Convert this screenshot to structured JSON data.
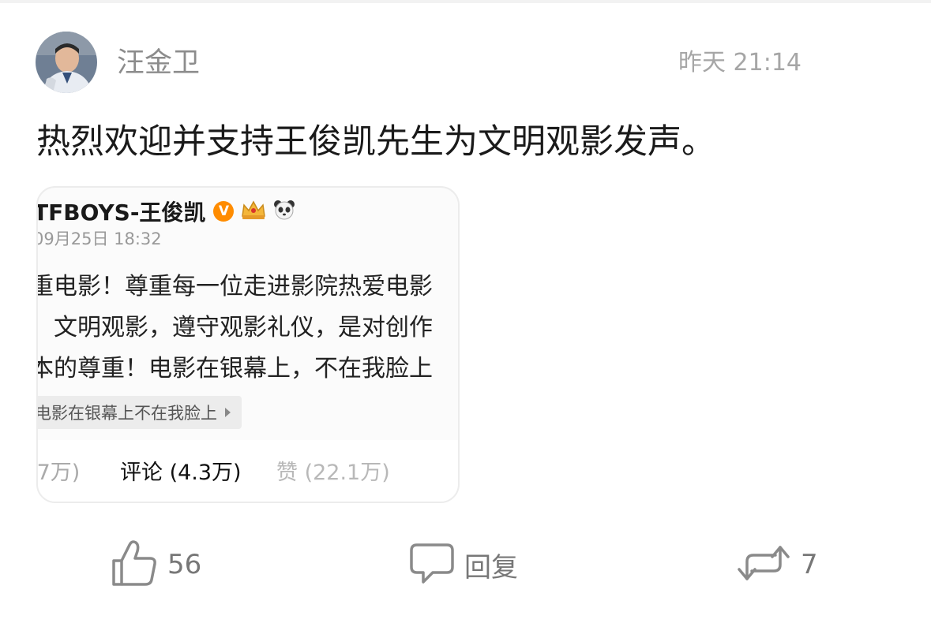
{
  "post": {
    "author": "汪金卫",
    "time": "昨天 21:14",
    "text": "热烈欢迎并支持王俊凯先生为文明观影发声。"
  },
  "quoted": {
    "author": "TFBOYS-王俊凯",
    "verified_badge": "V",
    "date": "09月25日 18:32",
    "lines": [
      "重电影！尊重每一位走进影院热爱电影",
      "，文明观影，遵守观影礼仪，是对创作",
      "本的尊重！电影在银幕上，不在我脸上"
    ],
    "topic": "电影在银幕上不在我脸上",
    "stats": {
      "repost": ".7万)",
      "comment": "评论 (4.3万)",
      "like": "赞 (22.1万)"
    }
  },
  "actions": {
    "like_count": "56",
    "reply_label": "回复",
    "repost_count": "7"
  },
  "colors": {
    "verified": "#ff8c00",
    "icon_gray": "#8a8a8a"
  },
  "icons": [
    "thumbs-up-icon",
    "comment-bubble-icon",
    "repost-icon",
    "crown-icon",
    "panda-icon"
  ]
}
